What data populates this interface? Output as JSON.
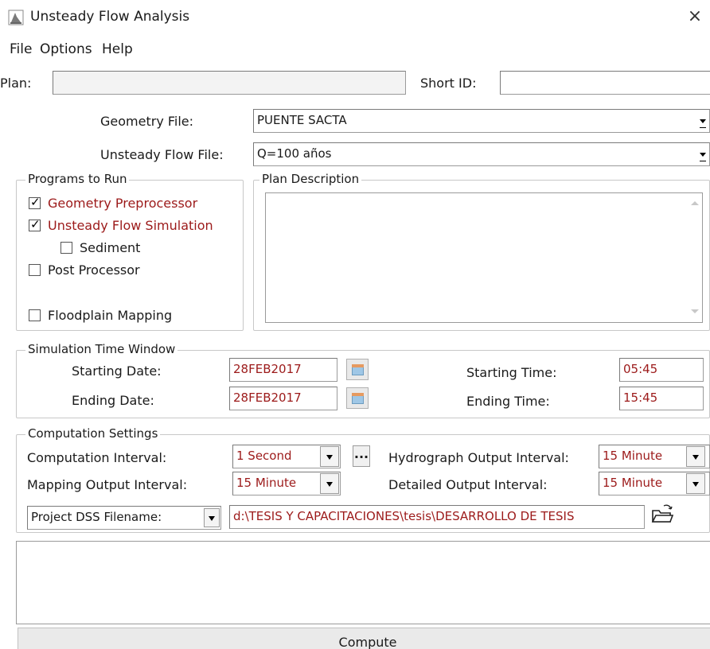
{
  "window": {
    "title": "Unsteady Flow Analysis",
    "close_symbol": "×"
  },
  "menu": {
    "items": [
      "File",
      "Options",
      "Help"
    ]
  },
  "plan": {
    "label": "Plan:",
    "value": "",
    "short_id_label": "Short ID:",
    "short_id_value": ""
  },
  "geometry": {
    "label": "Geometry File:",
    "value": "PUENTE SACTA"
  },
  "unsteady_flow": {
    "label": "Unsteady Flow File:",
    "value": "Q=100 años"
  },
  "programs": {
    "title": "Programs to Run",
    "items": [
      {
        "label": "Geometry Preprocessor",
        "checked": true
      },
      {
        "label": "Unsteady Flow Simulation",
        "checked": true
      },
      {
        "label": "Sediment",
        "checked": false
      },
      {
        "label": "Post Processor",
        "checked": false
      },
      {
        "label": "Floodplain Mapping",
        "checked": false
      }
    ]
  },
  "plan_description": {
    "title": "Plan Description",
    "value": ""
  },
  "sim_window": {
    "title": "Simulation Time Window",
    "starting_date_label": "Starting Date:",
    "starting_date": "28FEB2017",
    "ending_date_label": "Ending Date:",
    "ending_date": "28FEB2017",
    "starting_time_label": "Starting Time:",
    "starting_time": "05:45",
    "ending_time_label": "Ending Time:",
    "ending_time": "15:45"
  },
  "computation": {
    "title": "Computation Settings",
    "computation_interval_label": "Computation Interval:",
    "computation_interval": "1 Second",
    "dots_label": "...",
    "hydrograph_label": "Hydrograph Output Interval:",
    "hydrograph_interval": "15 Minute",
    "mapping_label": "Mapping Output Interval:",
    "mapping_interval": "15 Minute",
    "detailed_label": "Detailed Output Interval:",
    "detailed_interval": "15 Minute",
    "dss_selector": "Project DSS Filename:",
    "dss_path": "d:\\TESIS Y CAPACITACIONES\\tesis\\DESARROLLO DE TESIS"
  },
  "compute_button": "Compute",
  "colors": {
    "accent_red": "#9c1a1a"
  }
}
